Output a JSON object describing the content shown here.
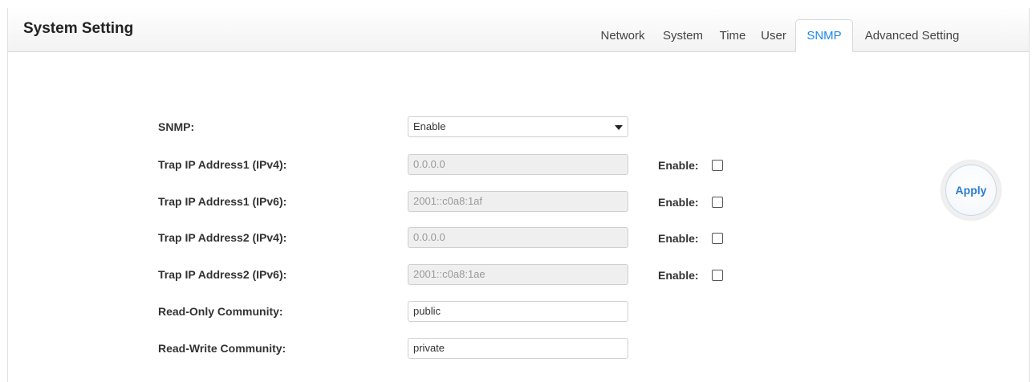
{
  "header": {
    "title": "System Setting"
  },
  "tabs": [
    {
      "label": "Network",
      "active": false
    },
    {
      "label": "System",
      "active": false
    },
    {
      "label": "Time",
      "active": false
    },
    {
      "label": "User",
      "active": false
    },
    {
      "label": "SNMP",
      "active": true
    },
    {
      "label": "Advanced Setting",
      "active": false
    }
  ],
  "form": {
    "snmp": {
      "label": "SNMP:",
      "value": "Enable"
    },
    "trap1_ipv4": {
      "label": "Trap IP Address1 (IPv4):",
      "value": "0.0.0.0",
      "enable_label": "Enable:",
      "enabled": false
    },
    "trap1_ipv6": {
      "label": "Trap IP Address1 (IPv6):",
      "value": "2001::c0a8:1af",
      "enable_label": "Enable:",
      "enabled": false
    },
    "trap2_ipv4": {
      "label": "Trap IP Address2 (IPv4):",
      "value": "0.0.0.0",
      "enable_label": "Enable:",
      "enabled": false
    },
    "trap2_ipv6": {
      "label": "Trap IP Address2 (IPv6):",
      "value": "2001::c0a8:1ae",
      "enable_label": "Enable:",
      "enabled": false
    },
    "ro_community": {
      "label": "Read-Only Community:",
      "value": "public"
    },
    "rw_community": {
      "label": "Read-Write Community:",
      "value": "private"
    }
  },
  "apply_label": "Apply",
  "colors": {
    "accent": "#1e88e5",
    "apply_text": "#2a7bd0"
  }
}
